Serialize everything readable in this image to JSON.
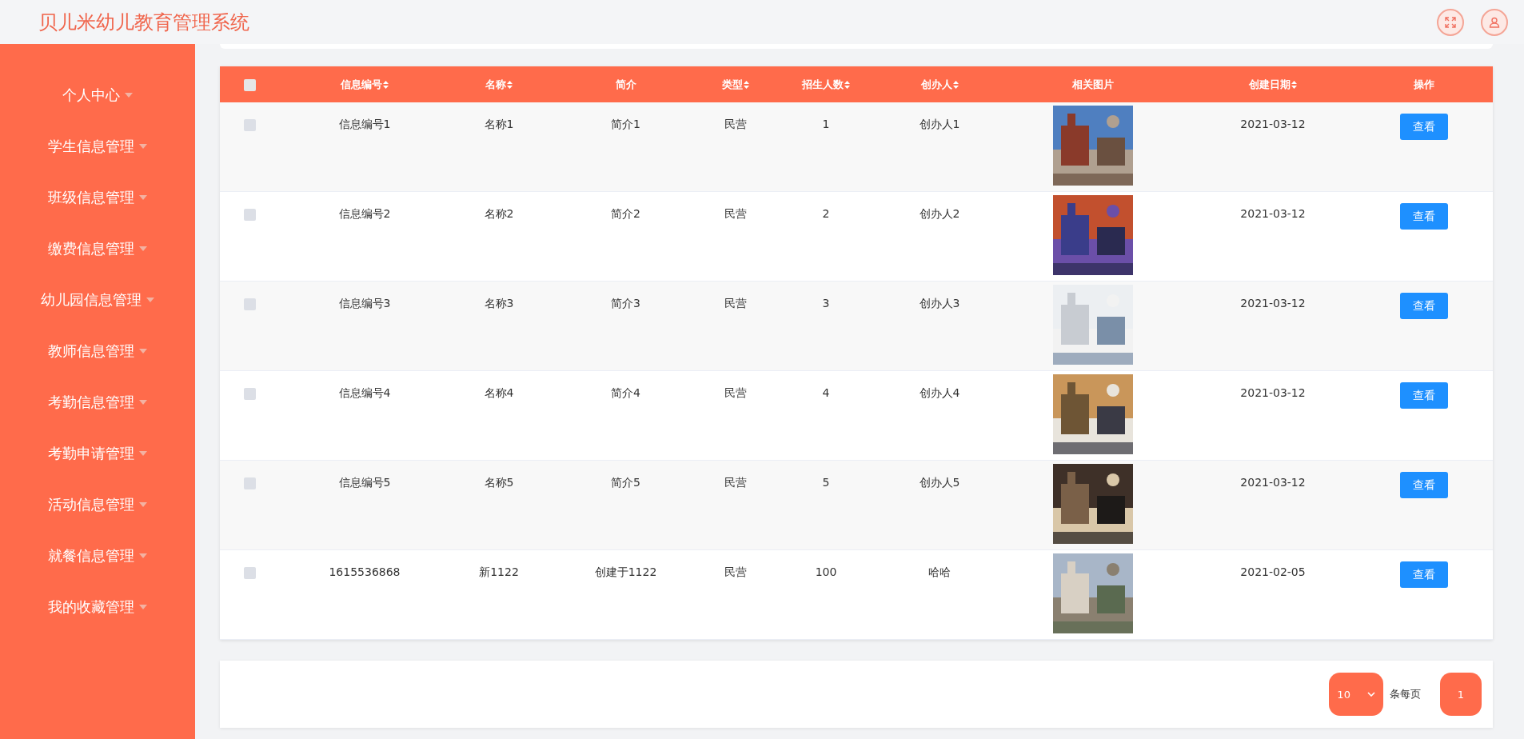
{
  "header": {
    "title": "贝儿米幼儿教育管理系统"
  },
  "sidebar": {
    "items": [
      {
        "label": "个人中心"
      },
      {
        "label": "学生信息管理"
      },
      {
        "label": "班级信息管理"
      },
      {
        "label": "缴费信息管理"
      },
      {
        "label": "幼儿园信息管理"
      },
      {
        "label": "教师信息管理"
      },
      {
        "label": "考勤信息管理"
      },
      {
        "label": "考勤申请管理"
      },
      {
        "label": "活动信息管理"
      },
      {
        "label": "就餐信息管理"
      },
      {
        "label": "我的收藏管理"
      }
    ]
  },
  "table": {
    "select_all": {
      "checked": false
    },
    "columns": [
      {
        "label": "信息编号",
        "sortable": true
      },
      {
        "label": "名称",
        "sortable": true
      },
      {
        "label": "简介",
        "sortable": false
      },
      {
        "label": "类型",
        "sortable": true
      },
      {
        "label": "招生人数",
        "sortable": true
      },
      {
        "label": "创办人",
        "sortable": true
      },
      {
        "label": "相关图片",
        "sortable": false
      },
      {
        "label": "创建日期",
        "sortable": true
      },
      {
        "label": "操作",
        "sortable": false
      }
    ],
    "rows": [
      {
        "checked": false,
        "cells": [
          "信息编号1",
          "名称1",
          "简介1",
          "民营",
          "1",
          "创办人1"
        ],
        "date": "2021-03-12",
        "action": "查看"
      },
      {
        "checked": false,
        "cells": [
          "信息编号2",
          "名称2",
          "简介2",
          "民营",
          "2",
          "创办人2"
        ],
        "date": "2021-03-12",
        "action": "查看"
      },
      {
        "checked": false,
        "cells": [
          "信息编号3",
          "名称3",
          "简介3",
          "民营",
          "3",
          "创办人3"
        ],
        "date": "2021-03-12",
        "action": "查看"
      },
      {
        "checked": false,
        "cells": [
          "信息编号4",
          "名称4",
          "简介4",
          "民营",
          "4",
          "创办人4"
        ],
        "date": "2021-03-12",
        "action": "查看"
      },
      {
        "checked": false,
        "cells": [
          "信息编号5",
          "名称5",
          "简介5",
          "民营",
          "5",
          "创办人5"
        ],
        "date": "2021-03-12",
        "action": "查看"
      },
      {
        "checked": false,
        "cells": [
          "1615536868",
          "新1122",
          "创建于1122",
          "民营",
          "100",
          "哈哈"
        ],
        "date": "2021-02-05",
        "action": "查看"
      }
    ]
  },
  "pagination": {
    "page_size": "10",
    "page_size_label": "条每页",
    "pages": [
      {
        "label": "1",
        "selected": true
      }
    ]
  }
}
